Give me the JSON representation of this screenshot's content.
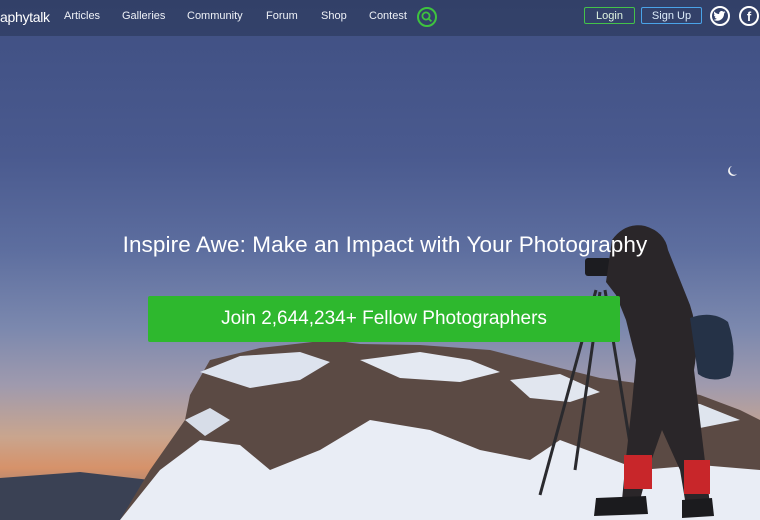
{
  "brand": {
    "logo_text": "aphytalk"
  },
  "nav": {
    "items": [
      {
        "label": "Articles"
      },
      {
        "label": "Galleries"
      },
      {
        "label": "Community"
      },
      {
        "label": "Forum"
      },
      {
        "label": "Shop"
      },
      {
        "label": "Contest"
      }
    ],
    "search_icon": "search-icon",
    "login_label": "Login",
    "signup_label": "Sign Up",
    "social": [
      {
        "icon": "twitter-icon"
      },
      {
        "icon": "facebook-icon",
        "glyph": "f"
      }
    ]
  },
  "hero": {
    "headline": "Inspire Awe: Make an Impact with Your Photography",
    "cta_label": "Join 2,644,234+ Fellow Photographers"
  },
  "colors": {
    "accent_green": "#2eb82e",
    "signup_blue": "#4aa3e8",
    "nav_bg": "rgba(40,52,84,0.55)"
  }
}
